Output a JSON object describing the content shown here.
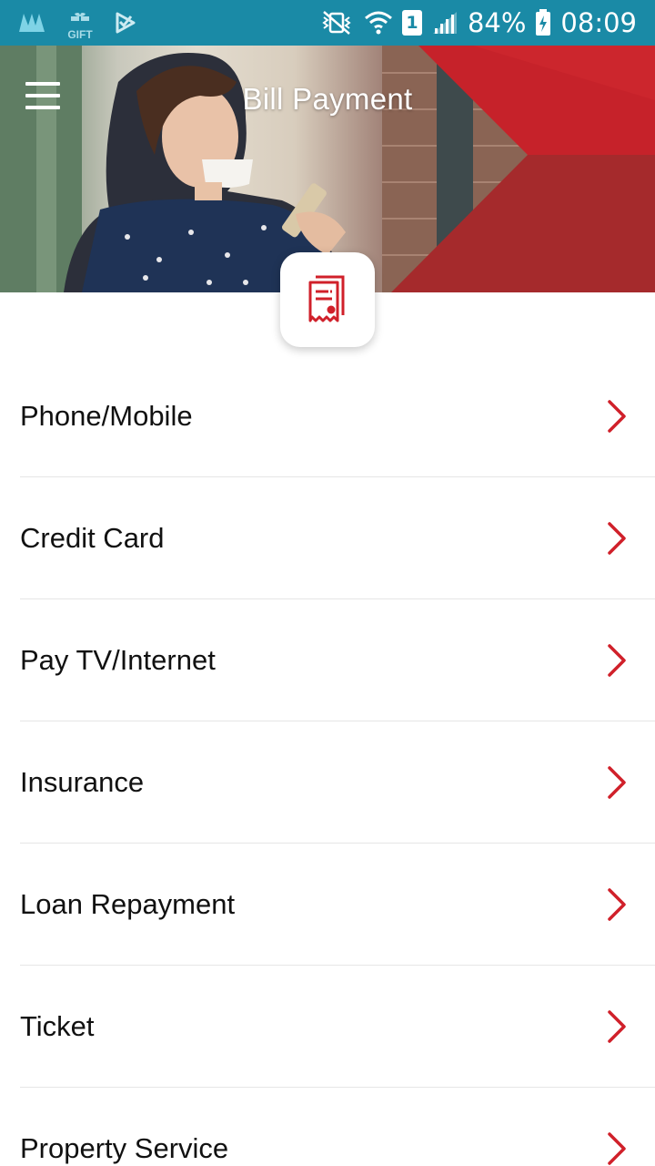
{
  "status_bar": {
    "notification_icons": [
      "m-app-icon",
      "gift-icon",
      "play-store-icon"
    ],
    "gift_label": "GIFT",
    "system_icons": [
      "vibrate-mute-icon",
      "wifi-icon",
      "sim-icon",
      "signal-icon"
    ],
    "sim_slot": "1",
    "battery_percent": "84%",
    "time": "08:09"
  },
  "header": {
    "title": "Bill Payment",
    "menu_icon": "hamburger-menu-icon",
    "badge_icon": "bill-receipt-icon"
  },
  "colors": {
    "status_bar": "#1a8aa6",
    "accent_red": "#d0202a",
    "text": "#111111",
    "divider": "#e6e6e6"
  },
  "bill_categories": [
    {
      "label": "Phone/Mobile"
    },
    {
      "label": "Credit Card"
    },
    {
      "label": "Pay TV/Internet"
    },
    {
      "label": "Insurance"
    },
    {
      "label": "Loan Repayment"
    },
    {
      "label": "Ticket"
    },
    {
      "label": "Property Service"
    }
  ]
}
